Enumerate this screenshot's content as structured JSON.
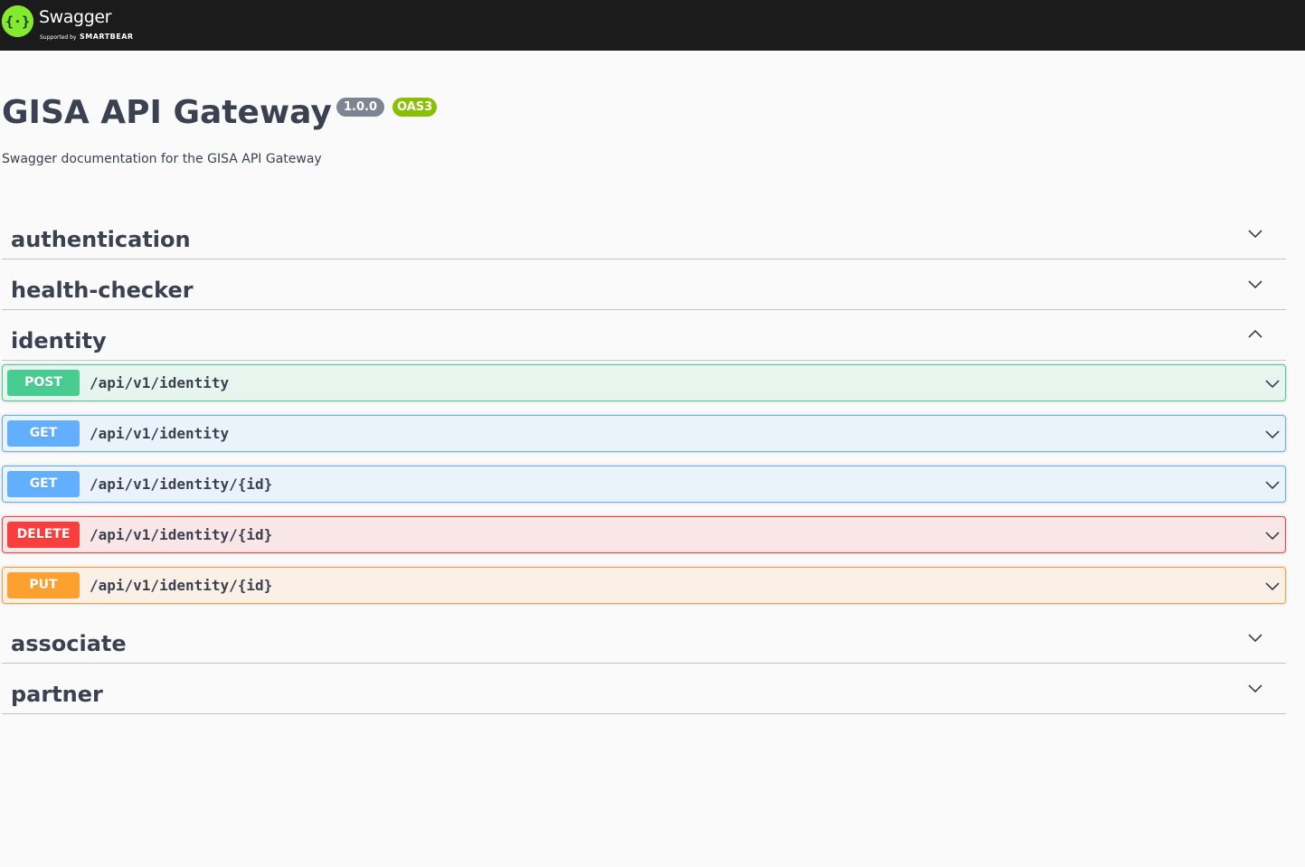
{
  "topbar": {
    "logo_name": "Swagger",
    "logo_sub_small": "Supported by",
    "logo_sub_brand": "SMARTBEAR",
    "logo_icon": "swagger-logo-icon"
  },
  "info": {
    "title": "GISA API Gateway",
    "version": "1.0.0",
    "oas": "OAS3",
    "description": "Swagger documentation for the GISA API Gateway"
  },
  "tags": [
    {
      "name": "authentication",
      "expanded": false
    },
    {
      "name": "health-checker",
      "expanded": false
    },
    {
      "name": "identity",
      "expanded": true
    },
    {
      "name": "associate",
      "expanded": false
    },
    {
      "name": "partner",
      "expanded": false
    }
  ],
  "operations": [
    {
      "method": "POST",
      "path": "/api/v1/identity"
    },
    {
      "method": "GET",
      "path": "/api/v1/identity"
    },
    {
      "method": "GET",
      "path": "/api/v1/identity/{id}"
    },
    {
      "method": "DELETE",
      "path": "/api/v1/identity/{id}"
    },
    {
      "method": "PUT",
      "path": "/api/v1/identity/{id}"
    }
  ],
  "colors": {
    "topbar": "#1b1b1b",
    "logo_green": "#85ea2d",
    "post": "#49cc90",
    "get": "#61affe",
    "delete": "#f93e3e",
    "put": "#fca130",
    "version_badge": "#7d8492",
    "oas_badge": "#89bf04"
  }
}
